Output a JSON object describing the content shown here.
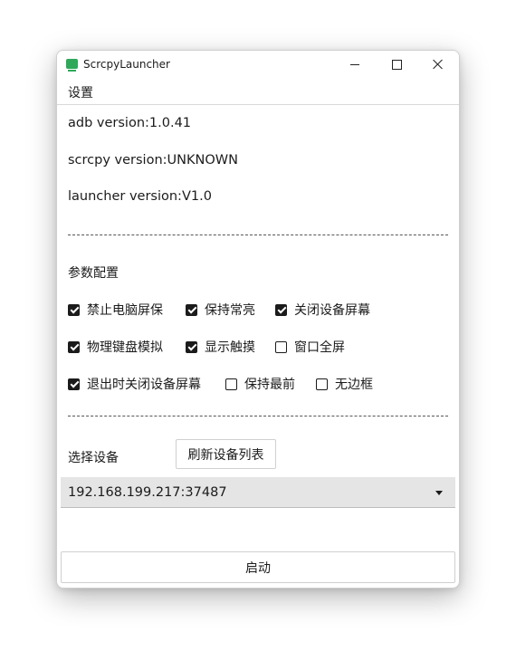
{
  "window": {
    "title": "ScrcpyLauncher",
    "accent_color": "#2fa85a"
  },
  "menu": {
    "settings_label": "设置"
  },
  "versions": {
    "adb": "adb version:1.0.41",
    "scrcpy": "scrcpy version:UNKNOWN",
    "launcher": "launcher version:V1.0"
  },
  "params": {
    "title": "参数配置",
    "options": [
      {
        "label": "禁止电脑屏保",
        "checked": true
      },
      {
        "label": "保持常亮",
        "checked": true
      },
      {
        "label": "关闭设备屏幕",
        "checked": true
      },
      {
        "label": "物理键盘模拟",
        "checked": true
      },
      {
        "label": "显示触摸",
        "checked": true
      },
      {
        "label": "窗口全屏",
        "checked": false
      },
      {
        "label": "退出时关闭设备屏幕",
        "checked": true
      },
      {
        "label": "保持最前",
        "checked": false
      },
      {
        "label": "无边框",
        "checked": false
      }
    ]
  },
  "device": {
    "select_label": "选择设备",
    "refresh_label": "刷新设备列表",
    "selected": "192.168.199.217:37487"
  },
  "start_label": "启动"
}
